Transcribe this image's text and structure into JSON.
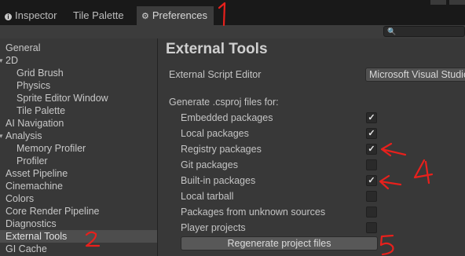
{
  "tabs": [
    {
      "label": "Inspector",
      "icon": "info-icon"
    },
    {
      "label": "Tile Palette"
    },
    {
      "label": "Preferences",
      "icon": "gear-icon",
      "active": true
    }
  ],
  "search": {
    "icon": "search-icon",
    "value": ""
  },
  "sidebar": {
    "items": [
      {
        "label": "General"
      },
      {
        "label": "2D",
        "expanded": true
      },
      {
        "label": "Grid Brush"
      },
      {
        "label": "Physics"
      },
      {
        "label": "Sprite Editor Window"
      },
      {
        "label": "Tile Palette"
      },
      {
        "label": "AI Navigation"
      },
      {
        "label": "Analysis",
        "expanded": true
      },
      {
        "label": "Memory Profiler"
      },
      {
        "label": "Profiler"
      },
      {
        "label": "Asset Pipeline"
      },
      {
        "label": "Cinemachine"
      },
      {
        "label": "Colors"
      },
      {
        "label": "Core Render Pipeline"
      },
      {
        "label": "Diagnostics"
      },
      {
        "label": "External Tools",
        "selected": true
      },
      {
        "label": "GI Cache"
      }
    ]
  },
  "main": {
    "title": "External Tools",
    "script_editor_label": "External Script Editor",
    "script_editor_value": "Microsoft Visual Studio",
    "generate_label": "Generate .csproj files for:",
    "options": [
      {
        "label": "Embedded packages",
        "checked": true
      },
      {
        "label": "Local packages",
        "checked": true
      },
      {
        "label": "Registry packages",
        "checked": true
      },
      {
        "label": "Git packages",
        "checked": false
      },
      {
        "label": "Built-in packages",
        "checked": true
      },
      {
        "label": "Local tarball",
        "checked": false
      },
      {
        "label": "Packages from unknown sources",
        "checked": false
      },
      {
        "label": "Player projects",
        "checked": false
      }
    ],
    "regenerate_label": "Regenerate project files"
  },
  "annotations": {
    "color": "#e8201c",
    "numbers": [
      "1",
      "2",
      "4",
      "5"
    ]
  }
}
